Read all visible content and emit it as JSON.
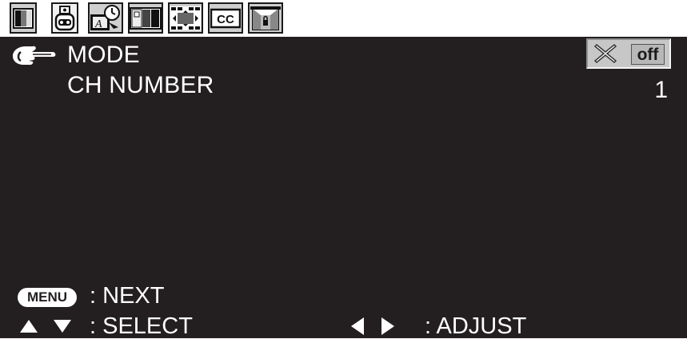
{
  "tabs": [
    {
      "icon": "picture-icon"
    },
    {
      "icon": "sound-icon"
    },
    {
      "icon": "timer-icon"
    },
    {
      "icon": "screen-mode-icon"
    },
    {
      "icon": "position-icon"
    },
    {
      "icon": "closed-caption-icon",
      "text": "CC"
    },
    {
      "icon": "lock-icon"
    }
  ],
  "menu": {
    "cursor_icon": "pointing-hand-icon",
    "mode_label": "MODE",
    "ch_number_label": "CH NUMBER",
    "ch_number_value": "1",
    "toggle_icon": "x-icon",
    "toggle_value": "off"
  },
  "help": {
    "menu_key": "MENU",
    "next": ": NEXT",
    "select": ": SELECT",
    "adjust": ": ADJUST"
  },
  "colors": {
    "panel_background": "#231f20",
    "text": "#ffffff",
    "tab_background": "#cfcfcf"
  }
}
